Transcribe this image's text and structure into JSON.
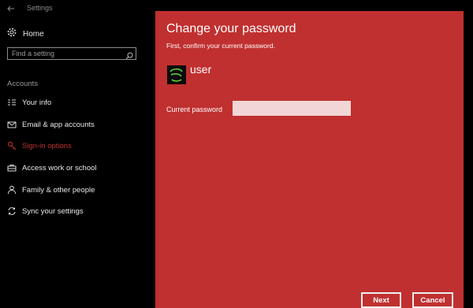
{
  "window": {
    "title": "Settings"
  },
  "sidebar": {
    "home_label": "Home",
    "search_placeholder": "Find a setting",
    "section_title": "Accounts",
    "items": [
      {
        "label": "Your info",
        "icon": "person-card-icon"
      },
      {
        "label": "Email & app accounts",
        "icon": "mail-icon"
      },
      {
        "label": "Sign-in options",
        "icon": "key-icon",
        "active": true
      },
      {
        "label": "Access work or school",
        "icon": "briefcase-icon"
      },
      {
        "label": "Family & other people",
        "icon": "person-icon"
      },
      {
        "label": "Sync your settings",
        "icon": "sync-icon"
      }
    ]
  },
  "dialog": {
    "title": "Change your password",
    "subtitle": "First, confirm your current password.",
    "username": "user",
    "password_label": "Current password",
    "password_value": "",
    "next_label": "Next",
    "cancel_label": "Cancel"
  },
  "colors": {
    "accent": "#c03030",
    "background": "#000000",
    "input_fill": "#f2d6d6"
  }
}
